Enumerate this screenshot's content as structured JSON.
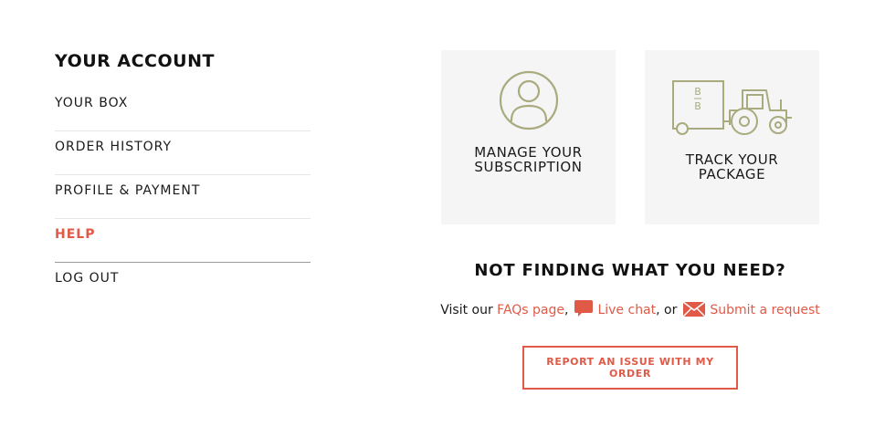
{
  "account": {
    "title": "YOUR ACCOUNT",
    "items": [
      {
        "label": "YOUR BOX"
      },
      {
        "label": "ORDER HISTORY"
      },
      {
        "label": "PROFILE & PAYMENT"
      },
      {
        "label": "HELP",
        "active": true
      },
      {
        "label": "LOG OUT"
      }
    ]
  },
  "cards": {
    "subscription": {
      "label": "MANAGE YOUR SUBSCRIPTION",
      "icon": "user-circle-icon"
    },
    "track": {
      "label": "TRACK YOUR PACKAGE",
      "icon": "tractor-icon",
      "icon_text": "B B"
    }
  },
  "help": {
    "title": "NOT FINDING WHAT YOU NEED?",
    "visit_text": "Visit our",
    "faqs_link": "FAQs page",
    "comma": ",",
    "live_chat_link": "Live chat",
    "or_text": ", or",
    "submit_link": "Submit a request",
    "report_button": "REPORT AN ISSUE WITH MY ORDER"
  },
  "colors": {
    "accent": "#e05a47",
    "icon_olive": "#a9ab7f",
    "card_bg": "#f5f5f5"
  }
}
